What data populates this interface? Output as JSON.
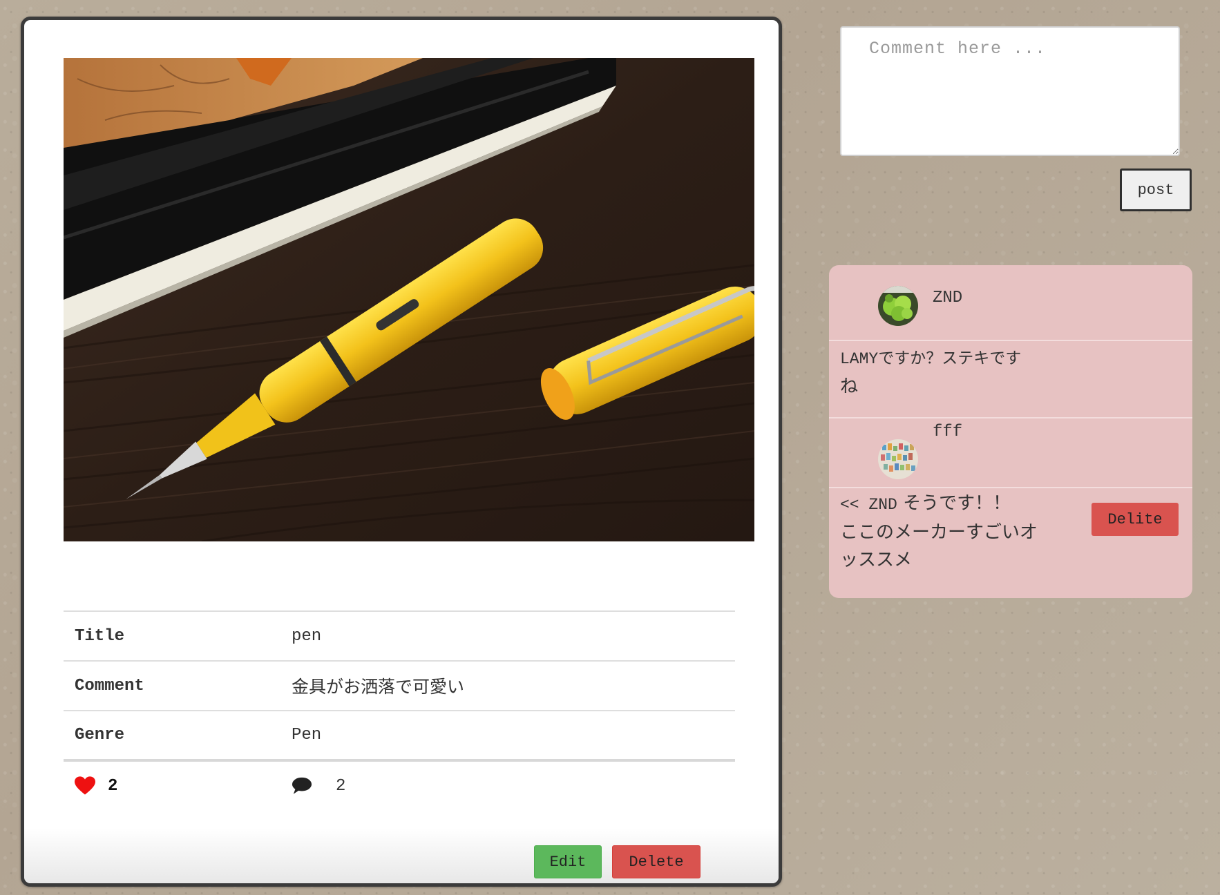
{
  "post": {
    "image_alt": "yellow fountain pen with cap on a dark wooden desk beside a notebook",
    "rows": [
      {
        "label": "Title",
        "value": "pen"
      },
      {
        "label": "Comment",
        "value": "金具がお洒落で可愛い"
      },
      {
        "label": "Genre",
        "value": "Pen"
      }
    ],
    "likes": "2",
    "comments_count": "2",
    "edit_label": "Edit",
    "delete_label": "Delete"
  },
  "comment_form": {
    "placeholder": "Comment here ...",
    "post_label": "post"
  },
  "comments": [
    {
      "user": "ZND",
      "text": "LAMYですか？ステキですね",
      "text_line1": "LAMYですか？ステキです",
      "text_line2": "ね"
    },
    {
      "user": "fff",
      "reply_to": "<< ZND",
      "text_line1": "そうです！！",
      "text_line2": "ここのメーカーすごいオ",
      "text_line3": "ッススメ",
      "delete_label": "Delite"
    }
  ],
  "colors": {
    "edit": "#5cb85c",
    "delete": "#d9534f",
    "comment_panel": "#e7c2c2",
    "heart": "#ee1111"
  },
  "icons": [
    "heart-icon",
    "comment-bubble-icon"
  ]
}
